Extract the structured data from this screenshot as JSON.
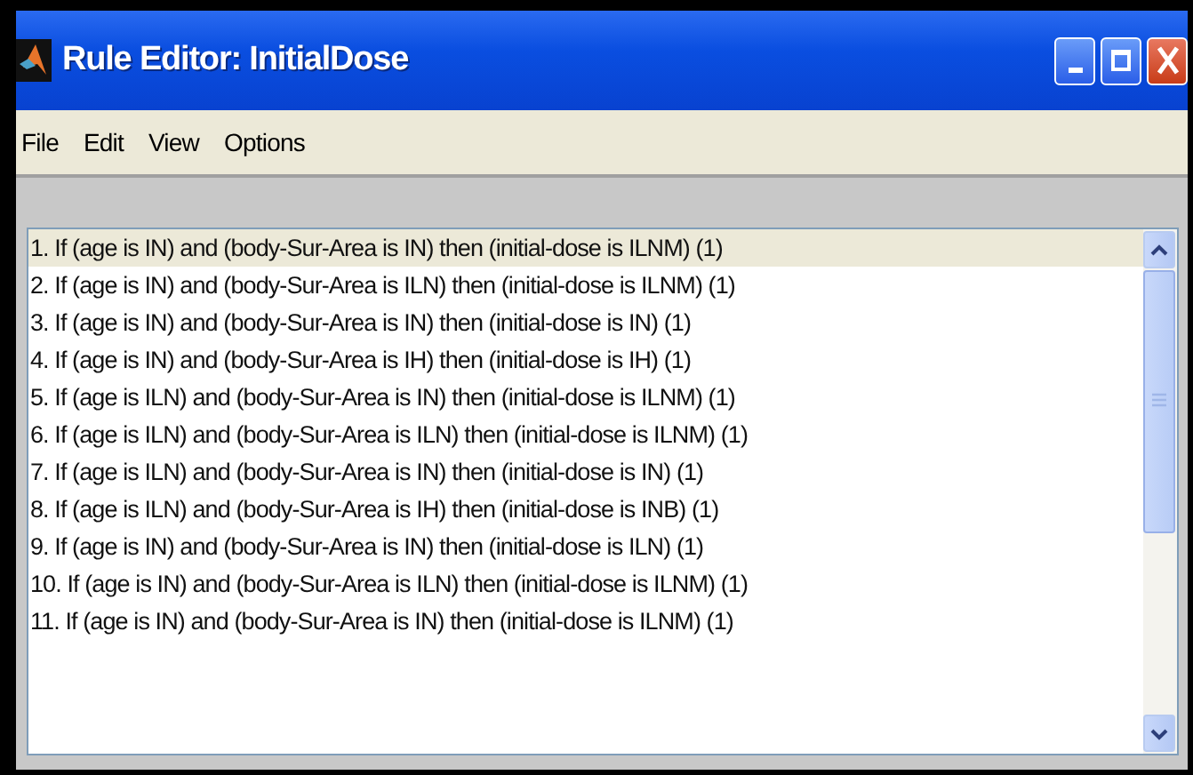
{
  "window": {
    "title": "Rule Editor: InitialDose"
  },
  "menu": [
    "File",
    "Edit",
    "View",
    "Options"
  ],
  "rules": [
    {
      "text": "1. If (age is IN) and (body-Sur-Area is IN) then (initial-dose is ILNM) (1)",
      "selected": true
    },
    {
      "text": "2. If (age is IN) and (body-Sur-Area is ILN) then (initial-dose is ILNM) (1)",
      "selected": false
    },
    {
      "text": "3. If (age is IN) and (body-Sur-Area is IN) then (initial-dose is IN) (1)",
      "selected": false
    },
    {
      "text": "4. If (age is IN) and (body-Sur-Area is IH) then (initial-dose is IH) (1)",
      "selected": false
    },
    {
      "text": "5. If (age is ILN) and (body-Sur-Area is IN) then (initial-dose is ILNM) (1)",
      "selected": false
    },
    {
      "text": "6. If (age is ILN) and (body-Sur-Area is ILN) then (initial-dose is ILNM) (1)",
      "selected": false
    },
    {
      "text": "7. If (age is ILN) and (body-Sur-Area is IN) then (initial-dose is IN) (1)",
      "selected": false
    },
    {
      "text": "8. If (age is ILN) and (body-Sur-Area is IH) then (initial-dose is INB) (1)",
      "selected": false
    },
    {
      "text": "9. If (age is IN) and (body-Sur-Area is IN) then (initial-dose is ILN) (1)",
      "selected": false
    },
    {
      "text": "10. If (age is IN) and (body-Sur-Area is ILN) then (initial-dose is ILNM) (1)",
      "selected": false
    },
    {
      "text": "11. If (age is IN) and (body-Sur-Area is IN) then (initial-dose is ILNM) (1)",
      "selected": false
    }
  ]
}
